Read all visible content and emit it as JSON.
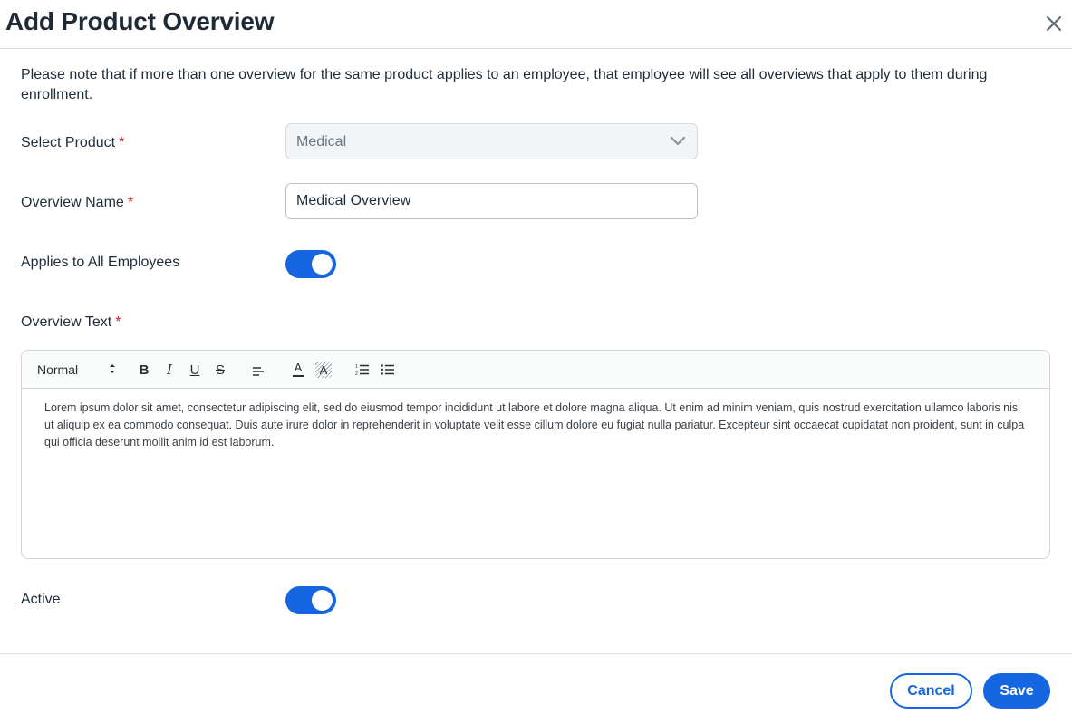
{
  "dialog": {
    "title": "Add Product Overview",
    "close_icon": "close-icon"
  },
  "note": "Please note that if more than one overview for the same product applies to an employee, that employee will see all overviews that apply to them during enrollment.",
  "fields": {
    "product": {
      "label": "Select Product",
      "required_marker": "*",
      "value": "Medical",
      "icon": "chevron-down-icon",
      "disabled": true
    },
    "overview_name": {
      "label": "Overview Name",
      "required_marker": "*",
      "value": "Medical Overview"
    },
    "applies_all": {
      "label": "Applies to All Employees",
      "on": true
    },
    "overview_text": {
      "label": "Overview Text",
      "required_marker": "*"
    },
    "active": {
      "label": "Active",
      "on": true
    }
  },
  "editor": {
    "style_select": "Normal",
    "toolbar_icons": [
      "updown-icon",
      "bold-icon",
      "italic-icon",
      "underline-icon",
      "strikethrough-icon",
      "align-icon",
      "text-color-icon",
      "background-color-icon",
      "ordered-list-icon",
      "bullet-list-icon"
    ],
    "bold": "B",
    "italic": "I",
    "underline": "U",
    "strike": "S",
    "color": "A",
    "bg": "A",
    "content": "Lorem ipsum dolor sit amet, consectetur adipiscing elit, sed do eiusmod tempor incididunt ut labore et dolore magna aliqua. Ut enim ad minim veniam, quis nostrud exercitation ullamco laboris nisi ut aliquip ex ea commodo consequat. Duis aute irure dolor in reprehenderit in voluptate velit esse cillum dolore eu fugiat nulla pariatur. Excepteur sint occaecat cupidatat non proident, sunt in culpa qui officia deserunt mollit anim id est laborum."
  },
  "footer": {
    "cancel_label": "Cancel",
    "save_label": "Save"
  },
  "colors": {
    "accent": "#1566e0",
    "required": "#d2232a",
    "title": "#1e2b37"
  }
}
